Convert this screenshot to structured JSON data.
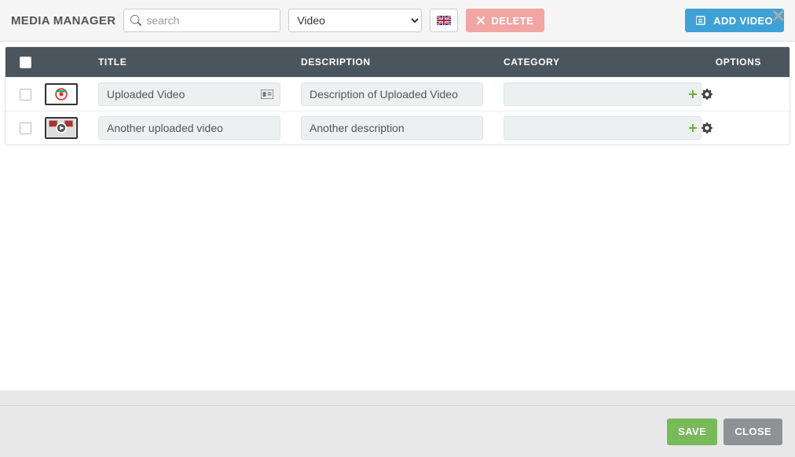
{
  "header": {
    "title": "MEDIA MANAGER",
    "search_placeholder": "search",
    "type_options": [
      "Video"
    ],
    "type_selected": "Video",
    "delete_label": "DELETE",
    "add_video_label": "ADD VIDEO",
    "flag": "uk"
  },
  "table": {
    "columns": {
      "title": "TITLE",
      "description": "DESCRIPTION",
      "category": "CATEGORY",
      "options": "OPTIONS"
    },
    "rows": [
      {
        "title": "Uploaded Video",
        "description": "Description of Uploaded Video",
        "category": "",
        "has_title_badge": true
      },
      {
        "title": "Another uploaded video",
        "description": "Another description",
        "category": "",
        "has_title_badge": false
      }
    ]
  },
  "footer": {
    "save_label": "SAVE",
    "close_label": "CLOSE"
  }
}
